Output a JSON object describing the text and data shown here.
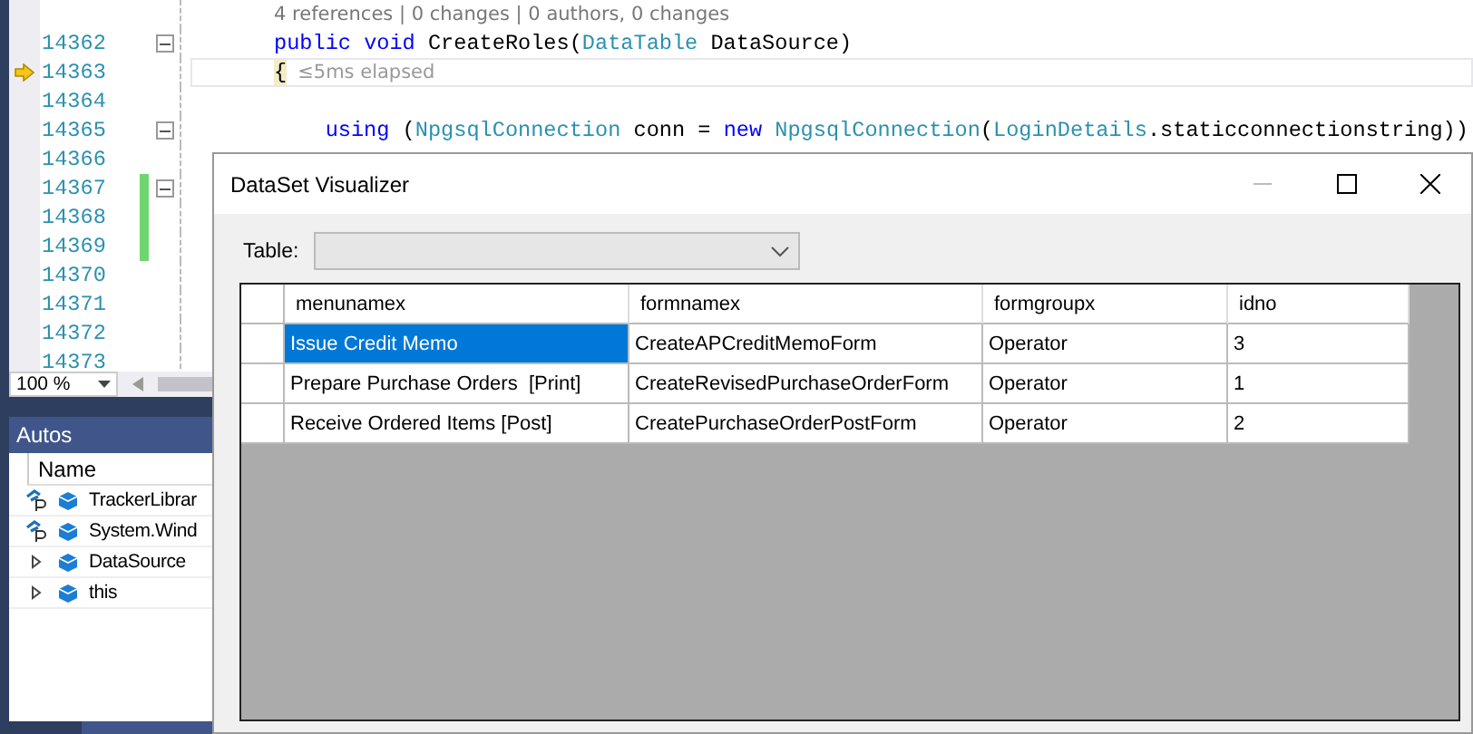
{
  "editor": {
    "code_lens": "4 references | 0 changes | 0 authors, 0 changes",
    "lines": [
      {
        "number": "14362",
        "foldable": true,
        "changed": false,
        "current": false,
        "tokens": [
          {
            "text": "public",
            "kind": "keyword"
          },
          {
            "text": " void",
            "kind": "keyword"
          },
          {
            "text": " CreateRoles(",
            "kind": "plain"
          },
          {
            "text": "DataTable",
            "kind": "type"
          },
          {
            "text": " DataSource)",
            "kind": "plain"
          }
        ]
      },
      {
        "number": "14363",
        "foldable": false,
        "changed": false,
        "current": true,
        "tokens": [
          {
            "text": "{",
            "kind": "brace"
          },
          {
            "text": "≤5ms elapsed",
            "kind": "hint"
          }
        ]
      },
      {
        "number": "14364",
        "foldable": false,
        "changed": false,
        "current": false
      },
      {
        "number": "14365",
        "foldable": true,
        "changed": false,
        "current": false,
        "tokens": [
          {
            "text": "    using",
            "kind": "keyword"
          },
          {
            "text": " (",
            "kind": "plain"
          },
          {
            "text": "NpgsqlConnection",
            "kind": "type"
          },
          {
            "text": " conn = ",
            "kind": "plain"
          },
          {
            "text": "new",
            "kind": "keyword"
          },
          {
            "text": " NpgsqlConnection",
            "kind": "type"
          },
          {
            "text": "(",
            "kind": "plain"
          },
          {
            "text": "LoginDetails",
            "kind": "type"
          },
          {
            "text": ".staticconnectionstring))",
            "kind": "plain"
          }
        ]
      },
      {
        "number": "14366",
        "foldable": false,
        "changed": false,
        "current": false
      },
      {
        "number": "14367",
        "foldable": true,
        "changed": true,
        "current": false
      },
      {
        "number": "14368",
        "foldable": false,
        "changed": true,
        "current": false
      },
      {
        "number": "14369",
        "foldable": false,
        "changed": true,
        "current": false
      },
      {
        "number": "14370",
        "foldable": false,
        "changed": false,
        "current": false
      },
      {
        "number": "14371",
        "foldable": false,
        "changed": false,
        "current": false
      },
      {
        "number": "14372",
        "foldable": false,
        "changed": false,
        "current": false
      },
      {
        "number": "14373",
        "foldable": false,
        "changed": false,
        "current": false
      }
    ]
  },
  "zoom": "100 %",
  "autos": {
    "title": "Autos",
    "column": "Name",
    "items": [
      {
        "name": "TrackerLibrar",
        "kind": "property"
      },
      {
        "name": "System.Wind",
        "kind": "property"
      },
      {
        "name": "DataSource",
        "kind": "expandable"
      },
      {
        "name": "this",
        "kind": "expandable"
      }
    ]
  },
  "dialog": {
    "title": "DataSet Visualizer",
    "table_label": "Table:",
    "columns": [
      "menunamex",
      "formnamex",
      "formgroupx",
      "idno"
    ],
    "rows": [
      {
        "selected": true,
        "cells": [
          "Issue Credit Memo",
          "CreateAPCreditMemoForm",
          "Operator",
          "3"
        ]
      },
      {
        "selected": false,
        "cells": [
          "Prepare Purchase Orders  [Print]",
          "CreateRevisedPurchaseOrderForm",
          "Operator",
          "1"
        ]
      },
      {
        "selected": false,
        "cells": [
          "Receive Ordered Items [Post]",
          "CreatePurchaseOrderPostForm",
          "Operator",
          "2"
        ]
      }
    ]
  }
}
